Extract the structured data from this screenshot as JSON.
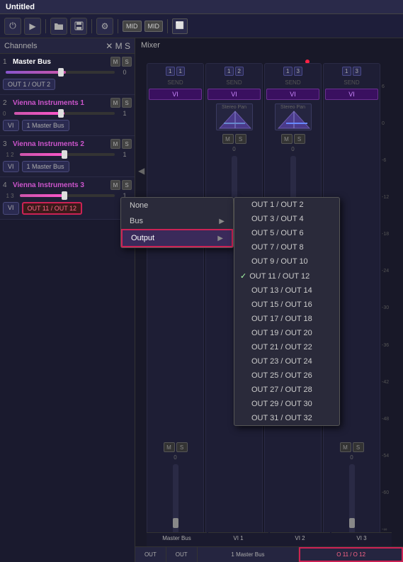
{
  "titlebar": {
    "title": "Untitled"
  },
  "toolbar": {
    "power": "⏻",
    "play": "▶",
    "folder_open": "📂",
    "save": "💾",
    "settings": "⚙",
    "midi1": "MID",
    "midi2": "MID",
    "window": "⬜"
  },
  "channels_panel": {
    "title": "Channels",
    "close": "✕",
    "channels": [
      {
        "num": "1",
        "name": "Master Bus",
        "class": "master",
        "m": "M",
        "s": "S",
        "fader_val": "0",
        "route1": "OUT 1 / OUT 2",
        "route2": ""
      },
      {
        "num": "2",
        "name": "Vienna Instruments 1",
        "class": "vi1",
        "m": "M",
        "s": "S",
        "fader_val": "1",
        "route1": "VI",
        "route2": "1 Master Bus"
      },
      {
        "num": "3",
        "name": "Vienna Instruments 2",
        "class": "vi2",
        "m": "M",
        "s": "S",
        "fader_val": "1",
        "route1": "VI",
        "route2": "1 Master Bus",
        "sub_vals": "1  2"
      },
      {
        "num": "4",
        "name": "Vienna Instruments 3",
        "class": "vi3",
        "m": "M",
        "s": "S",
        "fader_val": "1",
        "route1": "VI",
        "route2_highlighted": "OUT 11 / OUT 12",
        "sub_vals": "1  3"
      }
    ]
  },
  "mixer_panel": {
    "title": "Mixer",
    "channels": [
      {
        "nums": "1  1",
        "label": "VI",
        "show_pan": false,
        "bottom": "Master Bus"
      },
      {
        "nums": "1  2",
        "label": "VI",
        "show_pan": true,
        "bottom": "VI 1"
      },
      {
        "nums": "1  3",
        "label": "VI",
        "show_pan": true,
        "bottom": "VI 2"
      },
      {
        "nums": "1  3",
        "label": "VI",
        "show_pan": false,
        "bottom": "VI 3",
        "highlighted": true
      }
    ],
    "bottom_cells": [
      "OUT",
      "OUT",
      "1 Master Bus",
      "O 11 / O 12"
    ]
  },
  "context_menu": {
    "items": [
      {
        "label": "None",
        "type": "item"
      },
      {
        "label": "Bus",
        "type": "arrow"
      },
      {
        "label": "Output",
        "type": "arrow",
        "active": true
      }
    ]
  },
  "submenu": {
    "items": [
      {
        "label": "OUT 1 / OUT 2"
      },
      {
        "label": "OUT 3 / OUT 4"
      },
      {
        "label": "OUT 5 / OUT 6"
      },
      {
        "label": "OUT 7 / OUT 8"
      },
      {
        "label": "OUT 9 / OUT 10"
      },
      {
        "label": "OUT 11 / OUT 12",
        "checked": true
      },
      {
        "label": "OUT 13 / OUT 14"
      },
      {
        "label": "OUT 15 / OUT 16"
      },
      {
        "label": "OUT 17 / OUT 18"
      },
      {
        "label": "OUT 19 / OUT 20"
      },
      {
        "label": "OUT 21 / OUT 22"
      },
      {
        "label": "OUT 23 / OUT 24"
      },
      {
        "label": "OUT 25 / OUT 26"
      },
      {
        "label": "OUT 27 / OUT 28"
      },
      {
        "label": "OUT 29 / OUT 30"
      },
      {
        "label": "OUT 31 / OUT 32"
      }
    ]
  },
  "db_labels": [
    "6",
    "0",
    "-6",
    "-12",
    "-18",
    "-24",
    "-30",
    "-36",
    "-42",
    "-48",
    "-54",
    "-60",
    "-∞"
  ]
}
